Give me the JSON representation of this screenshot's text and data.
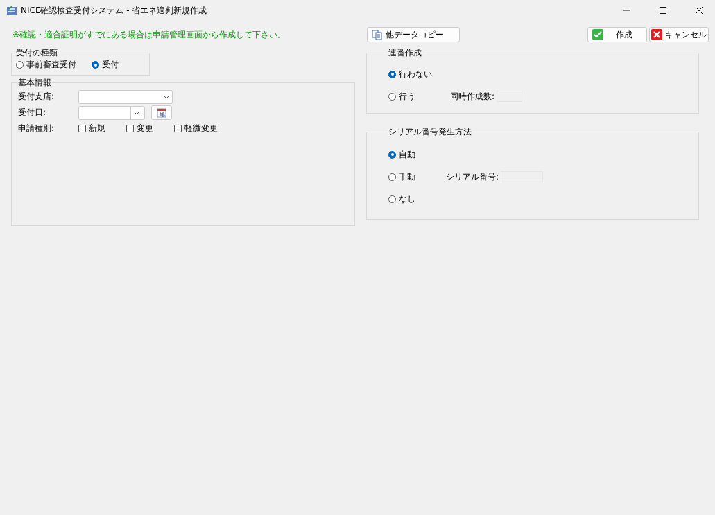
{
  "window": {
    "title": "NICE確認検査受付システム - 省エネ適判新規作成"
  },
  "notice": "※確認・適合証明がすでにある場合は申請管理画面から作成して下さい。",
  "buttons": {
    "copy": "他データコピー",
    "create": "作成",
    "cancel": "キャンセル"
  },
  "reception_type": {
    "label": "受付の種類",
    "options": [
      {
        "label": "事前審査受付",
        "selected": false
      },
      {
        "label": "受付",
        "selected": true
      }
    ]
  },
  "basic_info": {
    "label": "基本情報",
    "branch_label": "受付支店:",
    "date_label": "受付日:",
    "type_label": "申請種別:",
    "type_options": [
      {
        "label": "新規",
        "checked": false
      },
      {
        "label": "変更",
        "checked": false
      },
      {
        "label": "軽微変更",
        "checked": false
      }
    ]
  },
  "sequence": {
    "label": "連番作成",
    "options": [
      {
        "label": "行わない",
        "selected": true
      },
      {
        "label": "行う",
        "selected": false,
        "field_label": "同時作成数:"
      }
    ]
  },
  "serial": {
    "label": "シリアル番号発生方法",
    "options": [
      {
        "label": "自動",
        "selected": true
      },
      {
        "label": "手動",
        "selected": false,
        "field_label": "シリアル番号:"
      },
      {
        "label": "なし",
        "selected": false
      }
    ]
  }
}
